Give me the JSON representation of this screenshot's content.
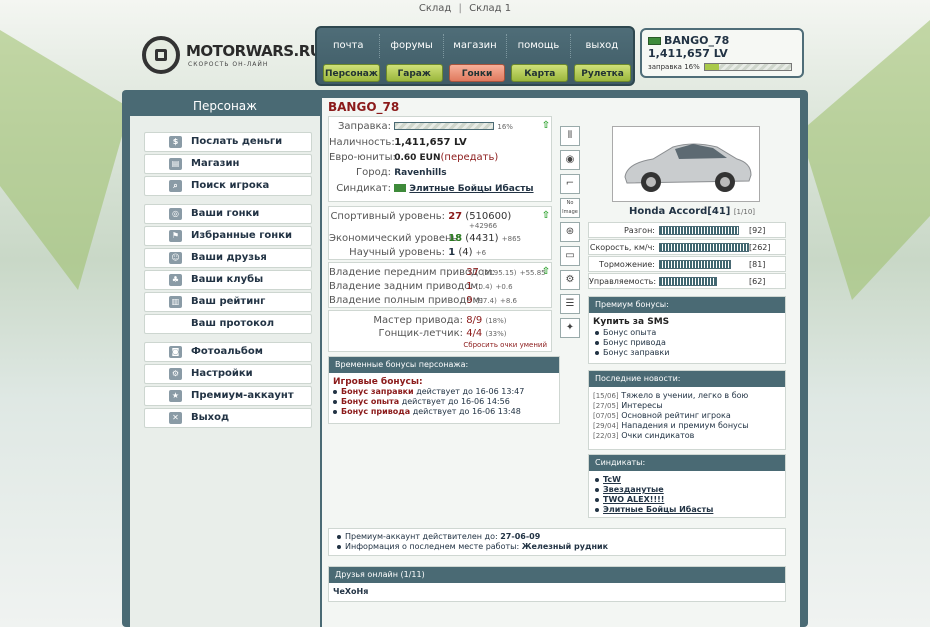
{
  "topbar": {
    "link1": "Склад",
    "sep": "|",
    "link2": "Склад 1"
  },
  "logo": {
    "name": "MOTORWARS.RU",
    "tagline": "СКОРОСТЬ ОН-ЛАЙН"
  },
  "nav": {
    "top": [
      "почта",
      "форумы",
      "магазин",
      "помощь",
      "выход"
    ],
    "bottom": [
      "Персонаж",
      "Гараж",
      "Гонки",
      "Карта",
      "Рулетка"
    ]
  },
  "user": {
    "name": "BANGO_78",
    "cash": "1,411,657 LV",
    "fuel_label": "заправка 16%",
    "fuel_pct": 16
  },
  "sidebar": {
    "title": "Персонаж",
    "items": [
      {
        "label": "Послать деньги",
        "icon": "money-icon"
      },
      {
        "label": "Магазин",
        "icon": "shop-icon"
      },
      {
        "label": "Поиск игрока",
        "icon": "search-icon"
      },
      {
        "label": "Ваши гонки",
        "icon": "steering-icon"
      },
      {
        "label": "Избранные гонки",
        "icon": "flag-icon"
      },
      {
        "label": "Ваши друзья",
        "icon": "friends-icon"
      },
      {
        "label": "Ваши клубы",
        "icon": "club-icon"
      },
      {
        "label": "Ваш рейтинг",
        "icon": "chart-icon"
      },
      {
        "label": "Ваш протокол",
        "icon": ""
      },
      {
        "label": "Фотоальбом",
        "icon": "camera-icon"
      },
      {
        "label": "Настройки",
        "icon": "settings-icon"
      },
      {
        "label": "Премиум-аккаунт",
        "icon": "premium-icon"
      },
      {
        "label": "Выход",
        "icon": "exit-icon"
      }
    ]
  },
  "character": {
    "name": "BANGO_78",
    "fuel_label": "Заправка:",
    "fuel_pct_text": "16%",
    "fuel_pct": 16,
    "cash_label": "Наличность:",
    "cash": "1,411,657 LV",
    "eun_label": "Евро-юниты:",
    "eun": "0.60 EUN",
    "eun_action": "(передать)",
    "city_label": "Город:",
    "city": "Ravenhills",
    "syndicate_label": "Синдикат:",
    "syndicate": "Элитные Бойцы Ибасты"
  },
  "levels": {
    "sport_label": "Спортивный уровень:",
    "sport": "27",
    "sport_pts": "(510600)",
    "sport_delta": "+42966",
    "eco_label": "Экономический уровень:",
    "eco": "18",
    "eco_pts": "(4431)",
    "eco_delta": "+865",
    "sci_label": "Научный уровень:",
    "sci": "1",
    "sci_pts": "(4)",
    "sci_delta": "+6"
  },
  "drive": {
    "front_label": "Владение передним приводом:",
    "front": "37",
    "front_pts": "(2195.15)",
    "front_delta": "+55.85",
    "rear_label": "Владение задним приводом:",
    "rear": "1",
    "rear_pts": "(0.4)",
    "rear_delta": "+0.6",
    "full_label": "Владение полным приводом:",
    "full": "9",
    "full_pts": "(97.4)",
    "full_delta": "+8.6"
  },
  "skills": {
    "master_label": "Мастер привода:",
    "master": "8/9",
    "master_pct": "(18%)",
    "pilot_label": "Гонщик-летчик:",
    "pilot": "4/4",
    "pilot_pct": "(33%)",
    "reset": "Сбросить очки умений"
  },
  "tempbonus": {
    "title": "Временные бонусы персонажа:",
    "sub": "Игровые бонусы:",
    "items": [
      {
        "name": "Бонус заправки",
        "text": "действует до 16-06 13:47"
      },
      {
        "name": "Бонус опыта",
        "text": "действует до 16-06 14:56"
      },
      {
        "name": "Бонус привода",
        "text": "действует до 16-06 13:48"
      }
    ]
  },
  "car": {
    "name": "Honda Accord[41]",
    "slot": "[1/10]",
    "stats": [
      {
        "label": "Разгон:",
        "value": "[92]",
        "level": 92
      },
      {
        "label": "Скорость, км/ч:",
        "value": "[262]",
        "level": 262
      },
      {
        "label": "Торможение:",
        "value": "[81]",
        "level": 81
      },
      {
        "label": "Управляемость:",
        "value": "[62]",
        "level": 62
      }
    ]
  },
  "premium": {
    "title": "Премиум бонусы:",
    "buy": "Купить за SMS",
    "items": [
      "Бонус опыта",
      "Бонус привода",
      "Бонус заправки"
    ]
  },
  "news": {
    "title": "Последние новости:",
    "items": [
      {
        "date": "[15/06]",
        "text": "Тяжело в учении, легко в бою"
      },
      {
        "date": "[27/05]",
        "text": "Интересы"
      },
      {
        "date": "[07/05]",
        "text": "Основной рейтинг игрока"
      },
      {
        "date": "[29/04]",
        "text": "Нападения и премиум бонусы"
      },
      {
        "date": "[22/03]",
        "text": "Очки синдикатов"
      }
    ]
  },
  "syndicates": {
    "title": "Синдикаты:",
    "items": [
      "TcW",
      "Звезданутые",
      "TWO ALEX!!!!",
      "Элитные Бойцы Ибасты"
    ]
  },
  "info": {
    "premium_label": "Премиум-аккаунт действителен до:",
    "premium_date": "27-06-09",
    "work_label": "Информация о последнем месте работы:",
    "work": "Железный рудник"
  },
  "friends": {
    "title": "Друзья онлайн (1/11)",
    "list": "ЧеХоНя"
  },
  "colors": {
    "accent": "#4a6a74",
    "dark_red": "#8b1a1a",
    "green_btn": "#a9c94a",
    "active_btn": "#e07a5e"
  }
}
